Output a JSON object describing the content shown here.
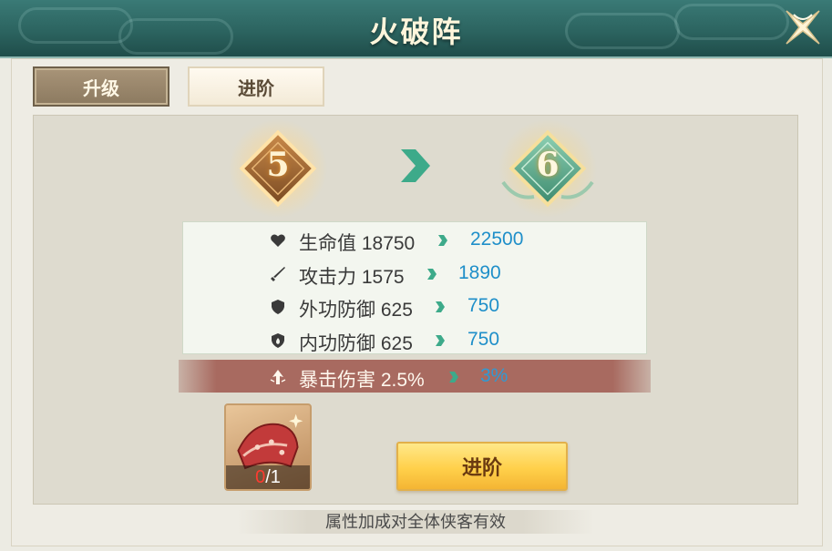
{
  "header": {
    "title": "火破阵"
  },
  "tabs": {
    "upgrade": "升级",
    "advance": "进阶"
  },
  "levels": {
    "current": "5",
    "next": "6"
  },
  "stats": [
    {
      "icon": "heart-icon",
      "label": "生命值",
      "from": "18750",
      "to": "22500"
    },
    {
      "icon": "sword-icon",
      "label": "攻击力",
      "from": "1575",
      "to": "1890"
    },
    {
      "icon": "shield-icon",
      "label": "外功防御",
      "from": "625",
      "to": "750"
    },
    {
      "icon": "flame-shield-icon",
      "label": "内功防御",
      "from": "625",
      "to": "750"
    }
  ],
  "highlight_stat": {
    "icon": "crit-arrow-icon",
    "label": "暴击伤害",
    "from": "2.5%",
    "to": "3%"
  },
  "material": {
    "icon": "scroll-icon",
    "have": "0",
    "need": "/1"
  },
  "buttons": {
    "advance": "进阶"
  },
  "footer": {
    "note": "属性加成对全体侠客有效"
  },
  "colors": {
    "title_bar": "#2c6460",
    "value_blue": "#1f8fc9",
    "accent_green": "#3daa8a",
    "button_gold": "#ffd04a"
  }
}
